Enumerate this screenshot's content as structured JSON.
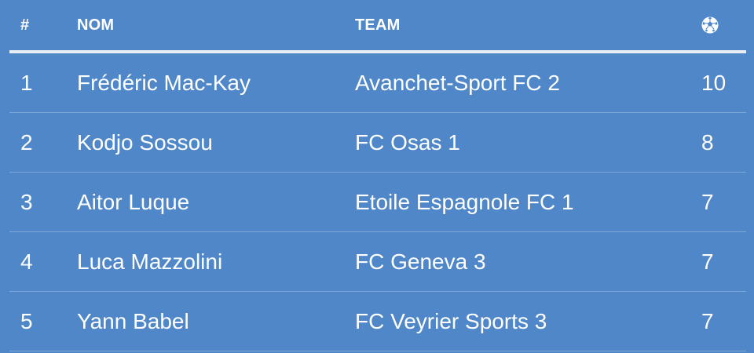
{
  "table": {
    "headers": {
      "rank": "#",
      "name": "NOM",
      "team": "TEAM",
      "goals_icon": "soccer-ball-icon"
    },
    "rows": [
      {
        "rank": "1",
        "name": "Frédéric Mac-Kay",
        "team": "Avanchet-Sport FC 2",
        "goals": "10"
      },
      {
        "rank": "2",
        "name": "Kodjo Sossou",
        "team": "FC Osas 1",
        "goals": "8"
      },
      {
        "rank": "3",
        "name": "Aitor Luque",
        "team": "Etoile Espagnole FC 1",
        "goals": "7"
      },
      {
        "rank": "4",
        "name": "Luca Mazzolini",
        "team": "FC Geneva 3",
        "goals": "7"
      },
      {
        "rank": "5",
        "name": "Yann Babel",
        "team": "FC Veyrier Sports 3",
        "goals": "7"
      }
    ]
  },
  "colors": {
    "background": "#4f87c9",
    "text": "#ffffff",
    "header_rule": "#e9eef5",
    "row_divider": "#7ea7d8"
  }
}
